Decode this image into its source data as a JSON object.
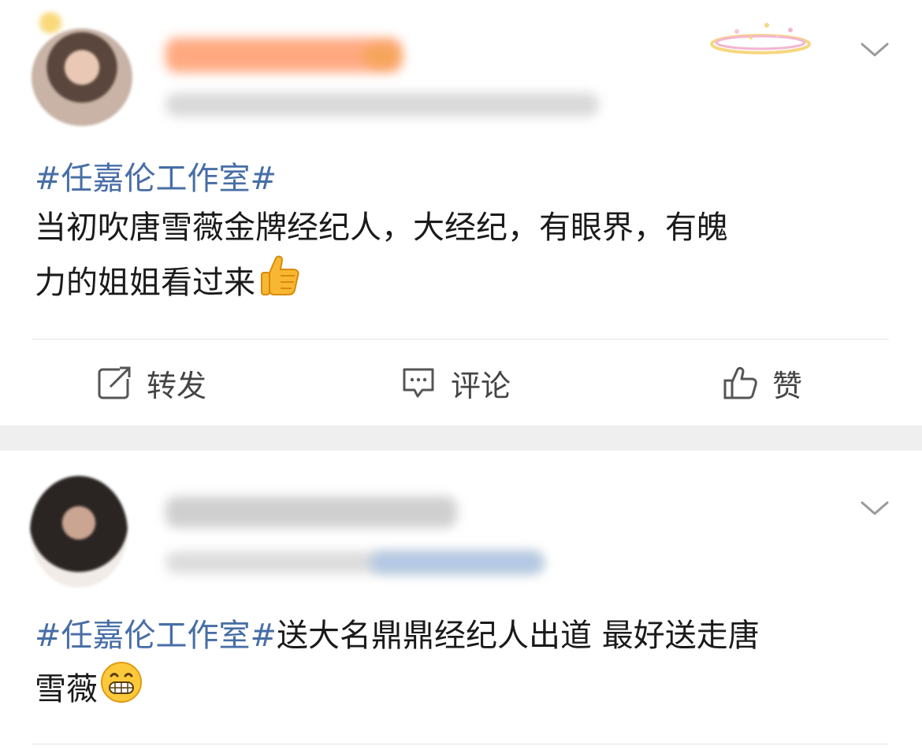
{
  "posts": [
    {
      "hashtag": "#任嘉伦工作室#",
      "body_line1": "当初吹唐雪薇金牌经纪人，大经纪，有眼界，有魄",
      "body_line2": "力的姐姐看过来",
      "emoji_icon": "thumbs-up-icon"
    },
    {
      "hashtag": "#任嘉伦工作室#",
      "body_line1": "送大名鼎鼎经纪人出道 最好送走唐",
      "body_line2": "雪薇",
      "emoji_icon": "grinning-face-icon"
    }
  ],
  "actions": {
    "repost_label": "转发",
    "comment_label": "评论",
    "like_label": "赞"
  },
  "colors": {
    "hashtag": "#476ea6",
    "text": "#1a1a1a",
    "separator": "#efefef"
  }
}
